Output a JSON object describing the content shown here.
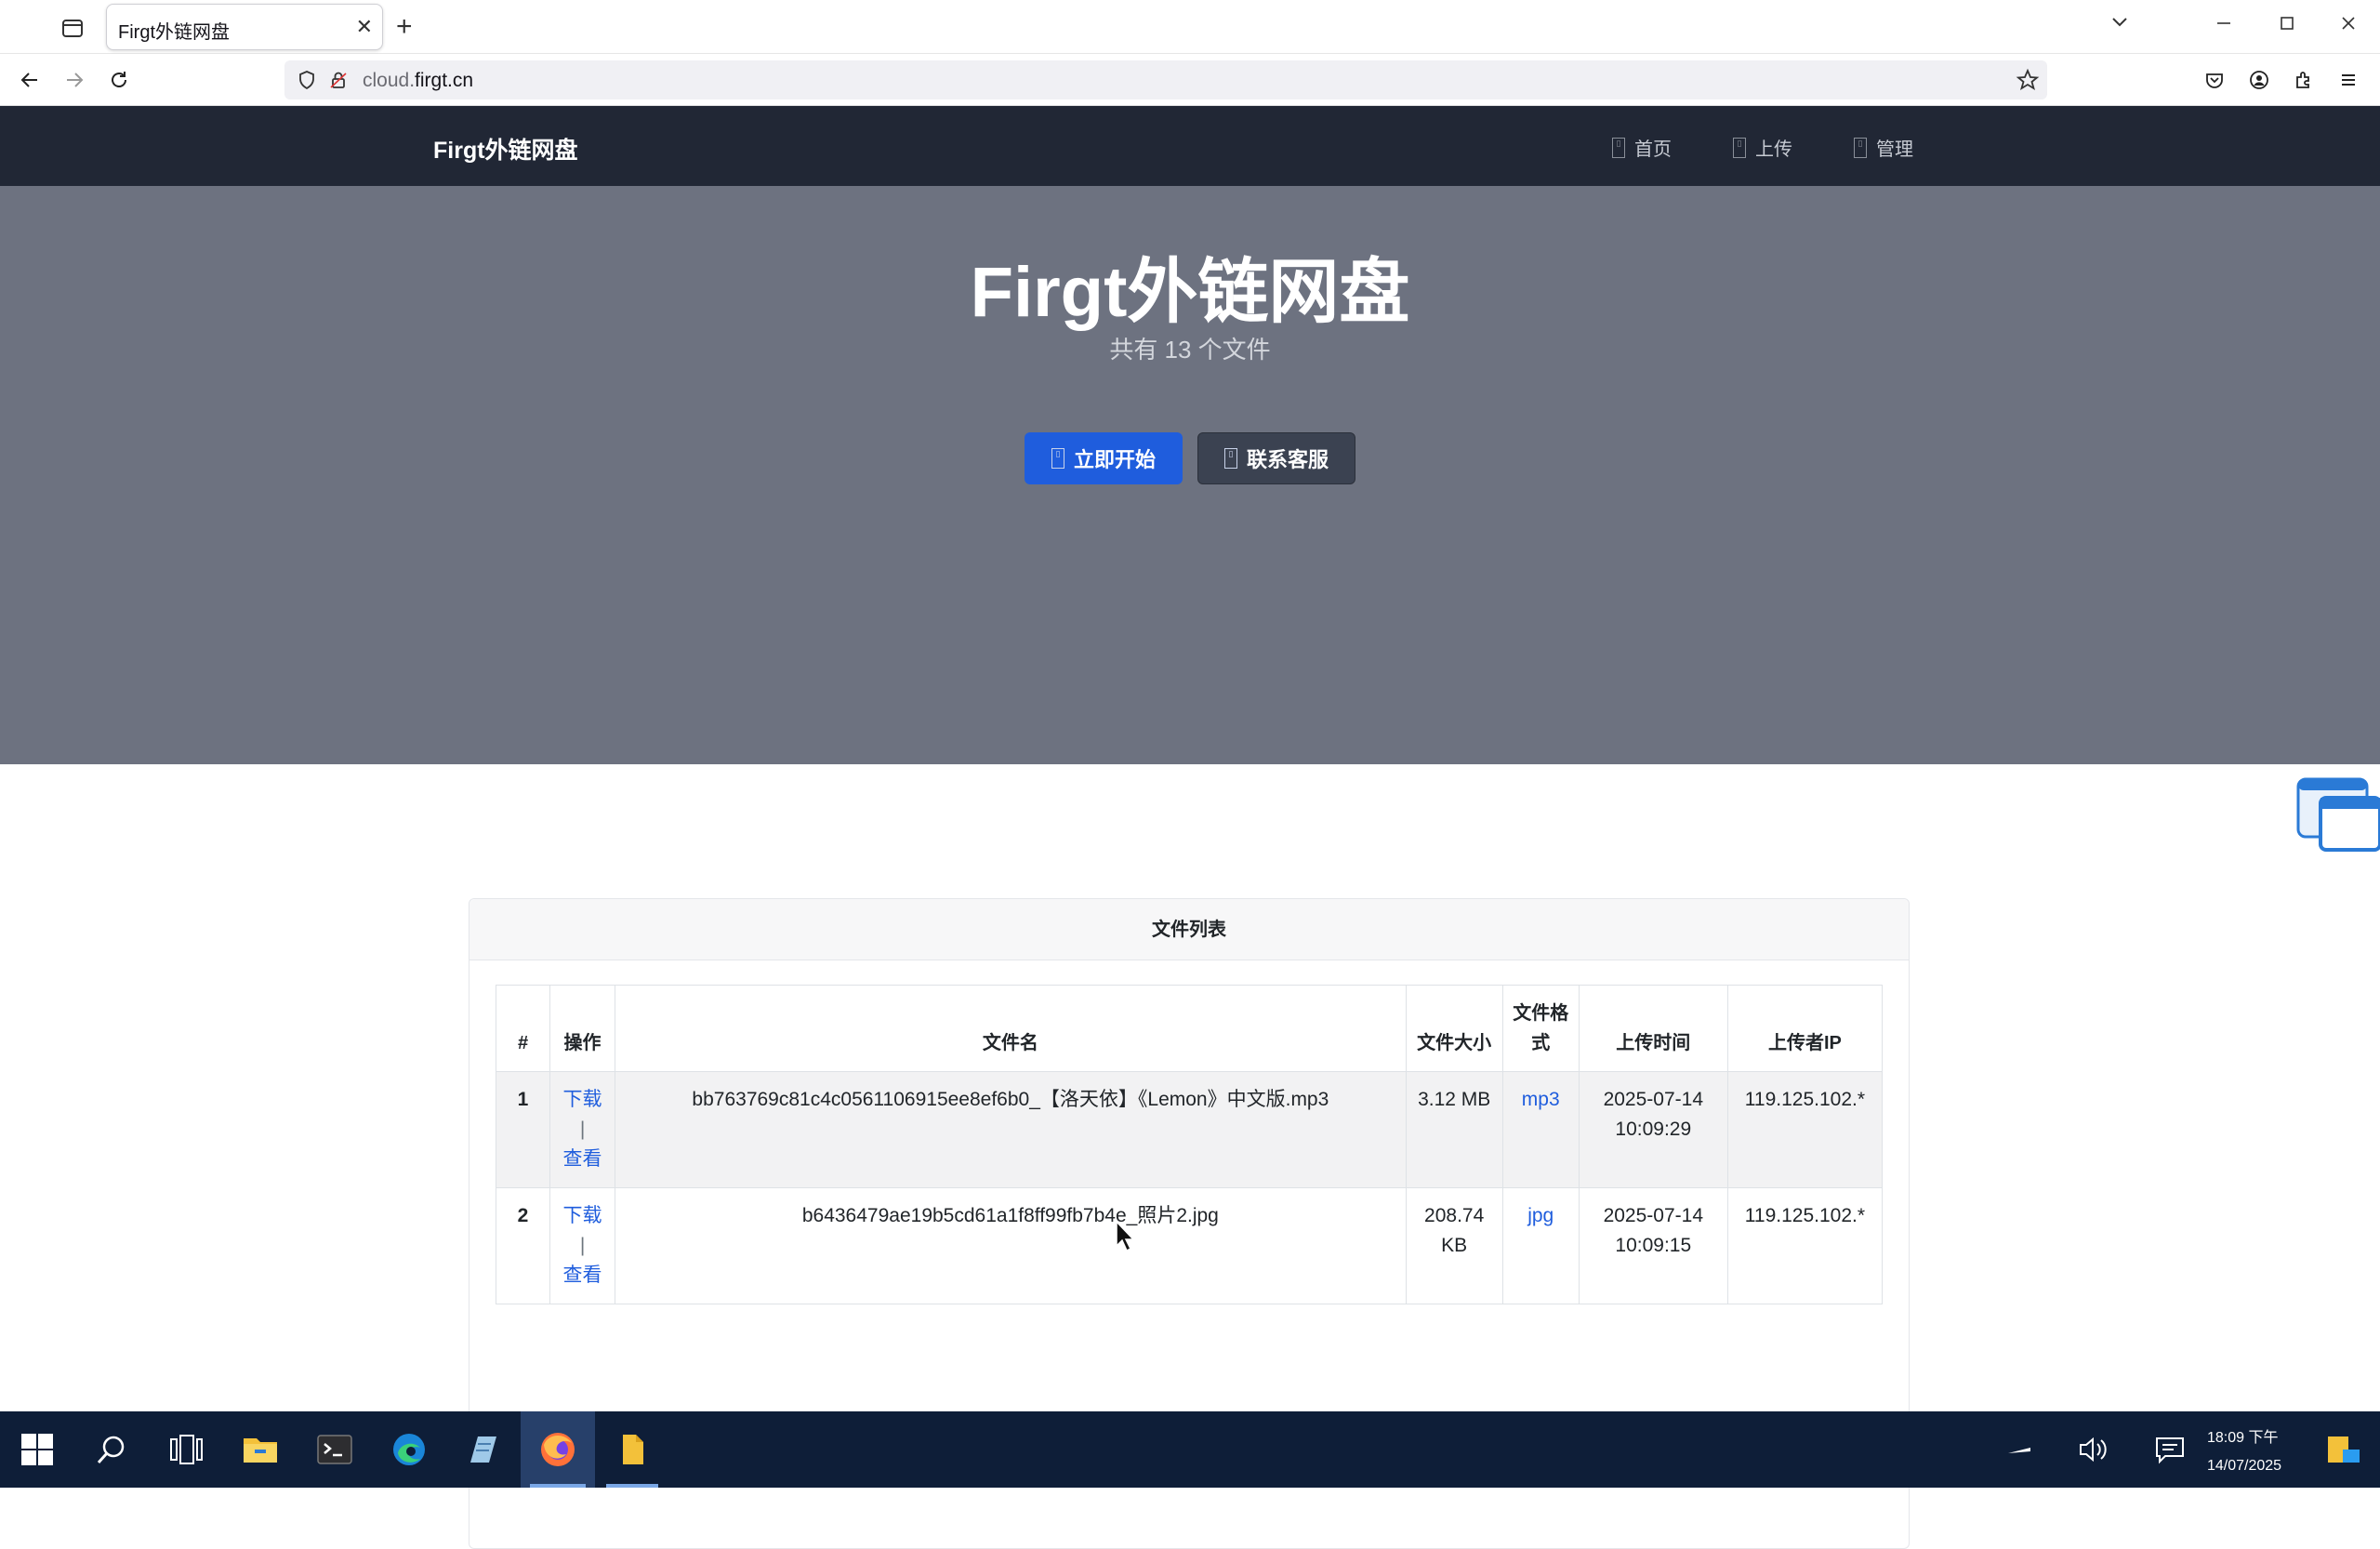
{
  "browser": {
    "tab_title": "Firgt外链网盘",
    "tab_close": "✕",
    "new_tab": "+",
    "url_prefix": "cloud.",
    "url_domain": "firgt.cn"
  },
  "site": {
    "brand": "Firgt外链网盘",
    "nav": [
      {
        "label": "首页"
      },
      {
        "label": "上传"
      },
      {
        "label": "管理"
      }
    ],
    "hero_title": "Firgt外链网盘",
    "hero_subtitle": "共有 13 个文件",
    "btn_start": "立即开始",
    "btn_contact": "联系客服"
  },
  "file_list": {
    "title": "文件列表",
    "headers": {
      "index": "#",
      "action": "操作",
      "filename": "文件名",
      "size": "文件大小",
      "format": "文件格式",
      "time": "上传时间",
      "ip": "上传者IP"
    },
    "action_download": "下载",
    "action_view": "查看",
    "rows": [
      {
        "index": "1",
        "filename": "bb763769c81c4c0561106915ee8ef6b0_【洛天依】《Lemon》中文版.mp3",
        "size": "3.12 MB",
        "format": "mp3",
        "time": "2025-07-14 10:09:29",
        "ip": "119.125.102.*"
      },
      {
        "index": "2",
        "filename": "b6436479ae19b5cd61a1f8ff99fb7b4e_照片2.jpg",
        "size": "208.74 KB",
        "format": "jpg",
        "time": "2025-07-14 10:09:15",
        "ip": "119.125.102.*"
      }
    ]
  },
  "taskbar": {
    "clock_time": "18:09 下午",
    "clock_date": "14/07/2025"
  },
  "colors": {
    "site_nav_bg": "#212735",
    "hero_bg": "#6d7280",
    "primary": "#1f5ddd",
    "taskbar_bg": "#0e1e38"
  }
}
